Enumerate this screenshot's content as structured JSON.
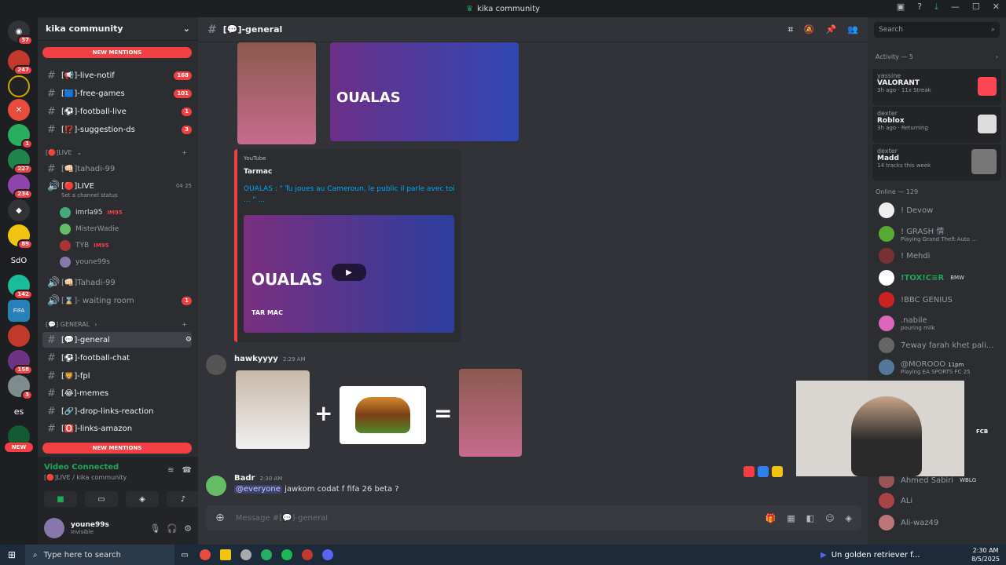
{
  "window": {
    "title": "kika community"
  },
  "rail": {
    "badges": [
      "37",
      "247",
      "1",
      "227",
      "234",
      "89",
      "142",
      "158",
      "3"
    ],
    "sdo": "SdO",
    "es": "es",
    "new": "NEW",
    "fifa": "FIFA"
  },
  "sidebar": {
    "server_name": "kika community",
    "new_mentions": "NEW MENTIONS",
    "channels": [
      {
        "icon": "#",
        "label": "[📢]-live-notif",
        "count": "168"
      },
      {
        "icon": "#",
        "label": "[🟦]-free-games",
        "count": "101"
      },
      {
        "icon": "#",
        "label": "[⚽]-football-live",
        "count": "1"
      },
      {
        "icon": "#",
        "label": "[⁉️]-suggestion-ds",
        "count": "3"
      }
    ],
    "cat_live": "[🔴]LIVE",
    "tahadi": "[👊🏻]tahadi-99",
    "live": "[🔴]LIVE",
    "live_counts": "04 25",
    "set_status": "Set a channel status",
    "voice_users": [
      {
        "name": "imrla95",
        "tag": "IM95"
      },
      {
        "name": "MisterWadie",
        "tag": ""
      },
      {
        "name": "TYB",
        "tag": "IM95"
      },
      {
        "name": "youne99s",
        "tag": ""
      }
    ],
    "tahadi2": "[👊🏻]Tahadi-99",
    "waiting": "[⌛]- waiting room",
    "waiting_count": "1",
    "cat_general": "[💬] GENERAL",
    "channels2": [
      {
        "label": "[💬]-general"
      },
      {
        "label": "[⚽]-football-chat"
      },
      {
        "label": "[🦁]-fpl"
      },
      {
        "label": "[😂]-memes"
      },
      {
        "label": "[🔗]-drop-links-reaction"
      },
      {
        "label": "[🅾️]-links-amazon"
      }
    ],
    "new_mentions2": "NEW MENTIONS"
  },
  "voice": {
    "status": "Video Connected",
    "channel": "[🔴]LIVE / kika community"
  },
  "user": {
    "name": "youne99s",
    "status": "Invisible"
  },
  "main": {
    "channel": "[💬]-general",
    "embed": {
      "provider": "YouTube",
      "author": "Tarmac",
      "title": "OUALAS : \" Tu joues au Cameroun, le public il parle avec toi ... \" ..."
    },
    "thumb_text": "OUALAS",
    "thumb_brand": "TAR MAC",
    "msg1": {
      "author": "hawkyyyy",
      "time": "2:29 AM"
    },
    "msg2": {
      "author": "Badr",
      "time": "2:30 AM",
      "mention": "@everyone",
      "text": "jawkom codat f fifa 26 beta ?"
    },
    "composer_placeholder": "Message #[💬]-general"
  },
  "right": {
    "search_placeholder": "Search",
    "activity_header": "Activity — 5",
    "activities": [
      {
        "user": "yassine",
        "game": "VALORANT",
        "meta": "3h ago",
        "extra": "11x Streak"
      },
      {
        "user": "dexter",
        "game": "Roblox",
        "meta": "3h ago",
        "extra": "Returning"
      },
      {
        "user": "dexter",
        "game": "Madd",
        "meta": "14 tracks this week",
        "extra": ""
      }
    ],
    "online_header": "Online — 129",
    "members": [
      {
        "name": "! Devow",
        "status": ""
      },
      {
        "name": "! GRASH 情",
        "status": "Playing Grand Theft Auto ..."
      },
      {
        "name": "! Mehdi",
        "status": ""
      },
      {
        "name": "!TOX!C≡R",
        "status": "",
        "tag": "BMW"
      },
      {
        "name": "!BBC GENIUS",
        "status": ""
      },
      {
        "name": ".nabile",
        "status": "pouring milk"
      },
      {
        "name": "7eway farah khet pali...",
        "status": ""
      },
      {
        "name": "@MOROOO",
        "status": "Playing EA SPORTS FC 25",
        "tag": "11pm"
      },
      {
        "name": "Ahmed Sabiri",
        "status": "",
        "tag": "WBLG"
      },
      {
        "name": "ALi",
        "status": ""
      },
      {
        "name": "Ali-waz49",
        "status": ""
      }
    ],
    "fcb": "FCB"
  },
  "taskbar": {
    "search": "Type here to search",
    "media": "Un golden retriever f...",
    "time": "2:30 AM",
    "date": "8/5/2025"
  },
  "colors": {
    "accent": "#5865f2",
    "danger": "#f23f43",
    "online": "#23a55a"
  }
}
